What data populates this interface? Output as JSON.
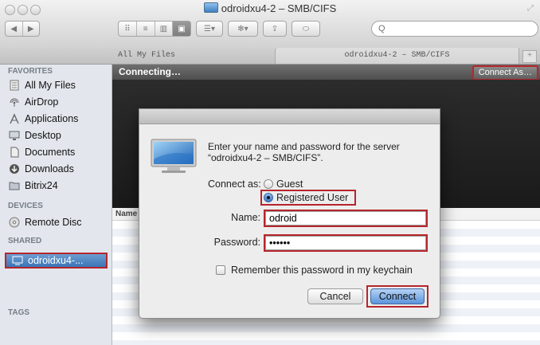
{
  "window": {
    "title": "odroidxu4-2 – SMB/CIFS"
  },
  "toolbar": {
    "search_placeholder": "Q"
  },
  "tabs": [
    "All My Files",
    "odroidxu4-2 – SMB/CIFS"
  ],
  "sidebar": {
    "favorites_header": "FAVORITES",
    "favorites": [
      "All My Files",
      "AirDrop",
      "Applications",
      "Desktop",
      "Documents",
      "Downloads",
      "Bitrix24"
    ],
    "devices_header": "DEVICES",
    "devices": [
      "Remote Disc"
    ],
    "shared_header": "SHARED",
    "shared": [
      "odroidxu4-..."
    ],
    "tags_header": "TAGS"
  },
  "main": {
    "status": "Connecting…",
    "connect_as_label": "Connect As…",
    "column_name": "Name"
  },
  "dialog": {
    "prompt": "Enter your name and password for the server “odroidxu4-2 – SMB/CIFS”.",
    "connect_as_label": "Connect as:",
    "guest_label": "Guest",
    "registered_label": "Registered User",
    "name_label": "Name:",
    "name_value": "odroid",
    "password_label": "Password:",
    "password_value": "••••••",
    "remember_label": "Remember this password in my keychain",
    "cancel_label": "Cancel",
    "connect_label": "Connect"
  },
  "colors": {
    "highlight_border": "#b5262c",
    "selection": "#3b74b5"
  }
}
